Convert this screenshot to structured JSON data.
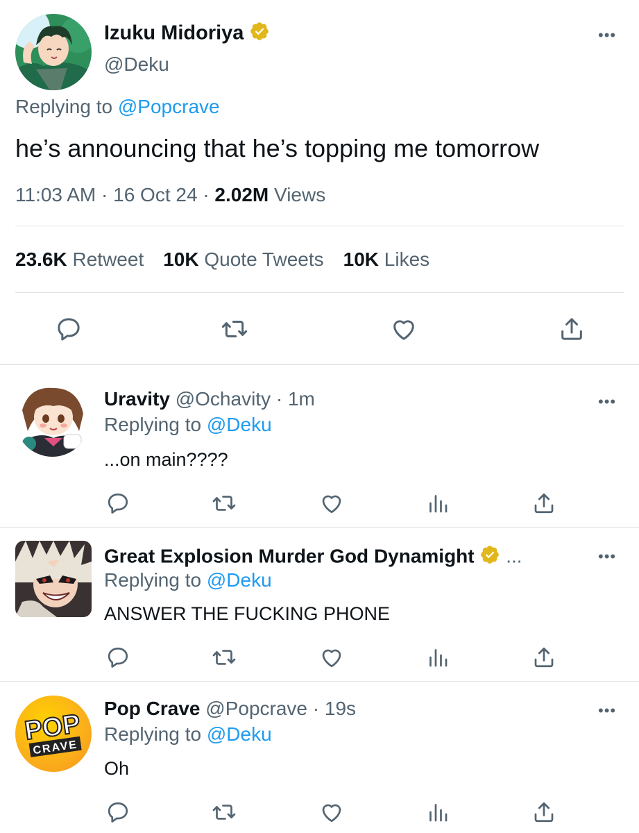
{
  "main_tweet": {
    "name": "Izuku Midoriya",
    "handle": "@Deku",
    "replying_label": "Replying to",
    "replying_to": "@Popcrave",
    "text": "he’s announcing that he’s topping me tomorrow",
    "time": "11:03 AM",
    "date": "16 Oct 24",
    "views_count": "2.02M",
    "views_label": "Views",
    "sep": "·"
  },
  "stats": {
    "retweets_count": "23.6K",
    "retweets_label": "Retweet",
    "quotes_count": "10K",
    "quotes_label": "Quote Tweets",
    "likes_count": "10K",
    "likes_label": "Likes"
  },
  "replies": [
    {
      "name": "Uravity",
      "handle": "@Ochavity",
      "time": "· 1m",
      "replying_label": "Replying to",
      "replying_to": "@Deku",
      "text": "...on main????"
    },
    {
      "name": "Great Explosion Murder God Dynamight",
      "overflow": "...",
      "replying_label": "Replying to",
      "replying_to": "@Deku",
      "text": "ANSWER THE FUCKING PHONE"
    },
    {
      "name": "Pop Crave",
      "handle": "@Popcrave",
      "time": "· 19s",
      "replying_label": "Replying to",
      "replying_to": "@Deku",
      "text": "Oh",
      "logo_top": "POP",
      "logo_bottom": "CRAVE"
    }
  ],
  "icons": {
    "more": "more-dots-icon",
    "reply": "reply-bubble-icon",
    "retweet": "retweet-icon",
    "like": "heart-icon",
    "analytics": "analytics-bars-icon",
    "share": "share-icon",
    "verified": "verified-badge-icon"
  },
  "colors": {
    "link_blue": "#1d9bf0",
    "secondary_gray": "#536471",
    "verified_gold": "#e2b719",
    "popcrave_orange": "#f7941d",
    "popcrave_yellow": "#ffd200"
  }
}
